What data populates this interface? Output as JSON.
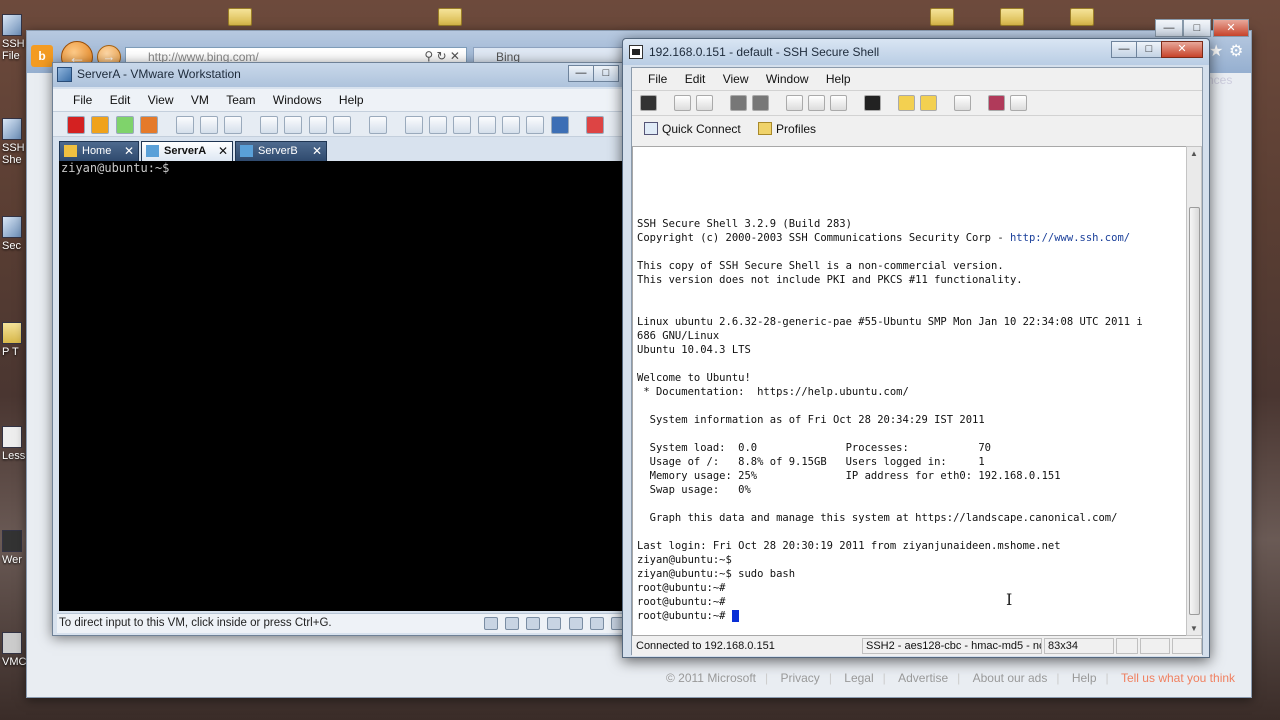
{
  "desktop": {
    "icons": [
      {
        "label": "SSH File",
        "icon": "ssh-file-transfer-icon"
      },
      {
        "label": "SSH She",
        "icon": "ssh-shell-icon"
      },
      {
        "label": "Sec",
        "icon": "secure-icon"
      },
      {
        "label": "P T",
        "icon": "folder-icon"
      },
      {
        "label": "Less",
        "icon": "document-icon"
      },
      {
        "label": "Wer",
        "icon": "app-icon"
      },
      {
        "label": "VMC",
        "icon": "vm-icon"
      }
    ]
  },
  "browser": {
    "address": "http://www.bing.com/",
    "tab_label": "Bing",
    "partial_right_text": "nces",
    "footer": {
      "copyright": "© 2011 Microsoft",
      "links": [
        "Privacy",
        "Legal",
        "Advertise",
        "About our ads",
        "Help"
      ],
      "feedback": "Tell us what you think"
    }
  },
  "vmware": {
    "title": "ServerA - VMware Workstation",
    "menu": [
      "File",
      "Edit",
      "View",
      "VM",
      "Team",
      "Windows",
      "Help"
    ],
    "tabs": [
      {
        "label": "Home",
        "icon": "home-icon",
        "active": false
      },
      {
        "label": "ServerA",
        "icon": "vm-icon",
        "active": true
      },
      {
        "label": "ServerB",
        "icon": "vm-icon",
        "active": false
      }
    ],
    "console_prompt": "ziyan@ubuntu:~$",
    "status_text": "To direct input to this VM, click inside or press Ctrl+G."
  },
  "ssh": {
    "title": "192.168.0.151 - default - SSH Secure Shell",
    "menu": [
      "File",
      "Edit",
      "View",
      "Window",
      "Help"
    ],
    "quick_connect": "Quick Connect",
    "profiles": "Profiles",
    "terminal": {
      "line01": "SSH Secure Shell 3.2.9 (Build 283)",
      "line02_pre": "Copyright (c) 2000-2003 SSH Communications Security Corp - ",
      "line02_link": "http://www.ssh.com/",
      "line03": "This copy of SSH Secure Shell is a non-commercial version.",
      "line04": "This version does not include PKI and PKCS #11 functionality.",
      "line05": "Linux ubuntu 2.6.32-28-generic-pae #55-Ubuntu SMP Mon Jan 10 22:34:08 UTC 2011 i",
      "line06": "686 GNU/Linux",
      "line07": "Ubuntu 10.04.3 LTS",
      "line08": "Welcome to Ubuntu!",
      "line09": " * Documentation:  https://help.ubuntu.com/",
      "line10": "  System information as of Fri Oct 28 20:34:29 IST 2011",
      "line11": "  System load:  0.0              Processes:           70",
      "line12": "  Usage of /:   8.8% of 9.15GB   Users logged in:     1",
      "line13": "  Memory usage: 25%              IP address for eth0: 192.168.0.151",
      "line14": "  Swap usage:   0%",
      "line15": "  Graph this data and manage this system at https://landscape.canonical.com/",
      "line16": "Last login: Fri Oct 28 20:30:19 2011 from ziyanjunaideen.mshome.net",
      "line17": "ziyan@ubuntu:~$",
      "line18": "ziyan@ubuntu:~$ sudo bash",
      "line19": "root@ubuntu:~#",
      "line20": "root@ubuntu:~#",
      "line21": "root@ubuntu:~# "
    },
    "status": {
      "connection": "Connected to 192.168.0.151",
      "cipher": "SSH2 - aes128-cbc - hmac-md5 - nc",
      "size": "83x34"
    }
  }
}
